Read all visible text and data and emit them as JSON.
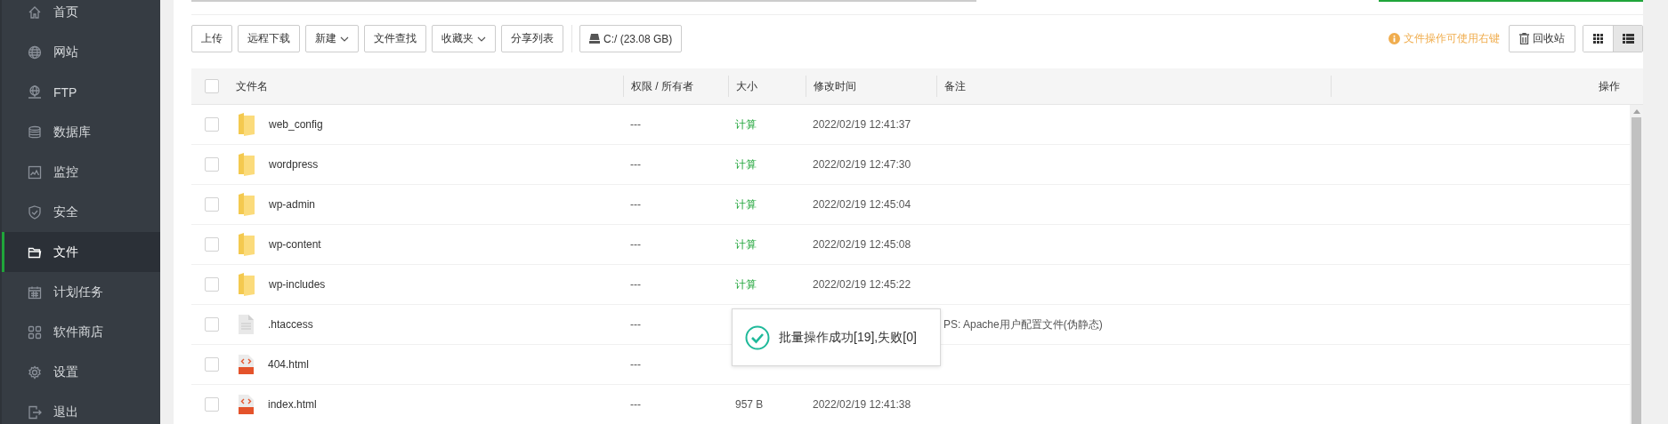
{
  "sidebar": {
    "items": [
      {
        "label": "首页",
        "selected": false
      },
      {
        "label": "网站",
        "selected": false
      },
      {
        "label": "FTP",
        "selected": false
      },
      {
        "label": "数据库",
        "selected": false
      },
      {
        "label": "监控",
        "selected": false
      },
      {
        "label": "安全",
        "selected": false
      },
      {
        "label": "文件",
        "selected": true
      },
      {
        "label": "计划任务",
        "selected": false
      },
      {
        "label": "软件商店",
        "selected": false
      },
      {
        "label": "设置",
        "selected": false
      },
      {
        "label": "退出",
        "selected": false
      }
    ]
  },
  "toolbar": {
    "buttons": [
      {
        "label": "上传",
        "has_menu": false
      },
      {
        "label": "远程下载",
        "has_menu": false
      },
      {
        "label": "新建",
        "has_menu": true
      },
      {
        "label": "文件查找",
        "has_menu": false
      },
      {
        "label": "收藏夹",
        "has_menu": true
      },
      {
        "label": "分享列表",
        "has_menu": false
      }
    ],
    "disk_button": "C:/ (23.08 GB)",
    "tip": "文件操作可使用右键",
    "recycle_button": "回收站",
    "view_toggle": [
      {
        "selected": false
      },
      {
        "selected": true
      }
    ]
  },
  "table": {
    "select_all_checked": false,
    "columns": [
      "文件名",
      "权限 / 所有者",
      "大小",
      "修改时间",
      "备注",
      "操作"
    ],
    "rows": [
      {
        "kind": "folder",
        "checked": false,
        "name": "web_config",
        "permission": "---",
        "size": "计算",
        "modified": "2022/02/19 12:41:37"
      },
      {
        "kind": "folder",
        "checked": false,
        "name": "wordpress",
        "permission": "---",
        "size": "计算",
        "modified": "2022/02/19 12:47:30"
      },
      {
        "kind": "folder",
        "checked": false,
        "name": "wp-admin",
        "permission": "---",
        "size": "计算",
        "modified": "2022/02/19 12:45:04"
      },
      {
        "kind": "folder",
        "checked": false,
        "name": "wp-content",
        "permission": "---",
        "size": "计算",
        "modified": "2022/02/19 12:45:08"
      },
      {
        "kind": "folder",
        "checked": false,
        "name": "wp-includes",
        "permission": "---",
        "size": "计算",
        "modified": "2022/02/19 12:45:22"
      },
      {
        "kind": "file",
        "checked": false,
        "name": ".htaccess",
        "permission": "---",
        "note": "PS: Apache用户配置文件(伪静态)"
      },
      {
        "kind": "html",
        "checked": false,
        "name": "404.html",
        "permission": "---"
      },
      {
        "kind": "html",
        "checked": false,
        "name": "index.html",
        "permission": "---",
        "size": "957 B",
        "modified": "2022/02/19 12:41:38"
      }
    ]
  },
  "toast": {
    "message": "批量操作成功[19],失败[0]"
  }
}
